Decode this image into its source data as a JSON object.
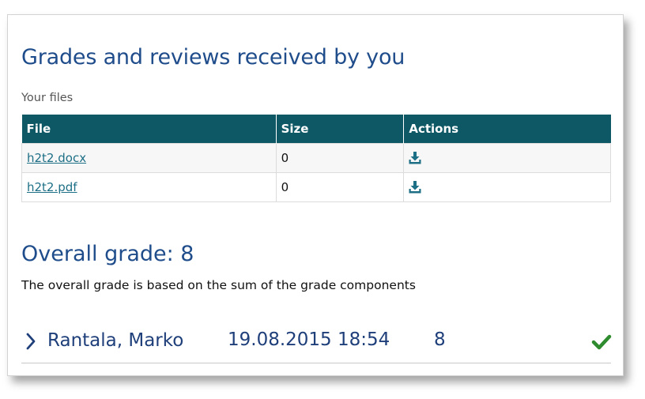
{
  "header": {
    "title": "Grades and reviews received by you"
  },
  "files_section": {
    "label": "Your files",
    "columns": [
      "File",
      "Size",
      "Actions"
    ],
    "rows": [
      {
        "file": "h2t2.docx",
        "size": "0",
        "action_icon": "download-icon"
      },
      {
        "file": "h2t2.pdf",
        "size": "0",
        "action_icon": "download-icon"
      }
    ]
  },
  "overall": {
    "heading": "Overall grade: 8",
    "description": "The overall grade is based on the sum of the grade components"
  },
  "reviews": [
    {
      "reviewer": "Rantala, Marko",
      "date": "19.08.2015 18:54",
      "grade": "8",
      "status_icon": "check-icon"
    }
  ],
  "colors": {
    "accent_blue": "#1f4c8a",
    "table_header": "#0e5866",
    "link": "#1d6f86",
    "check_green": "#2e8b2e"
  }
}
